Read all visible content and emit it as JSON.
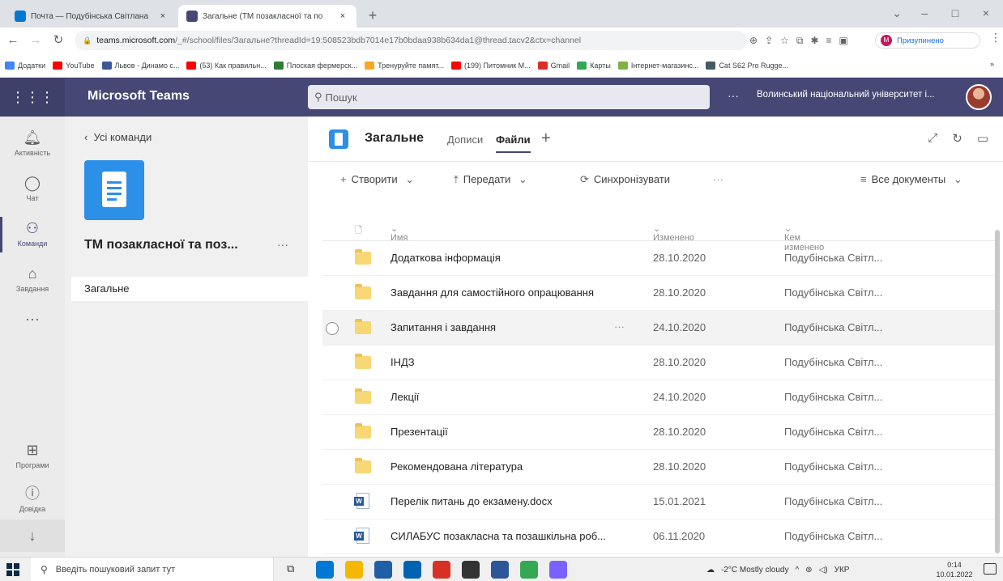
{
  "browser": {
    "tabs": [
      {
        "title": "Почта — Подубінська Світлана",
        "close": "×"
      },
      {
        "title": "Загальне (ТМ позакласної та по",
        "close": "×"
      }
    ],
    "new_tab": "+",
    "window_controls": [
      "⌄",
      "–",
      "□",
      "×"
    ],
    "url_host": "teams.microsoft.com",
    "url_rest": "/_#/school/files/Загальне?threadId=19:508523bdb7014e17b0bdaa938b634da1@thread.tacv2&ctx=channel",
    "profile_status": "Призупинено",
    "profile_initial": "M",
    "bookmarks": [
      {
        "label": "Додатки",
        "color": "#4285f4"
      },
      {
        "label": "YouTube",
        "color": "#ff0000"
      },
      {
        "label": "Львов - Динамо с...",
        "color": "#3b5998"
      },
      {
        "label": "(53) Как правильн...",
        "color": "#ff0000"
      },
      {
        "label": "Плоская фермерск...",
        "color": "#2e7d32"
      },
      {
        "label": "Тренуруйте памят...",
        "color": "#f9a825"
      },
      {
        "label": "(199) Питомник М...",
        "color": "#ff0000"
      },
      {
        "label": "Gmail",
        "color": "#d93025"
      },
      {
        "label": "Карты",
        "color": "#34a853"
      },
      {
        "label": "Інтернет-магазинс...",
        "color": "#7cb342"
      },
      {
        "label": "Cat S62 Pro Rugge...",
        "color": "#455a64"
      }
    ],
    "bookmarks_more": "»"
  },
  "teams": {
    "brand": "Microsoft Teams",
    "search_placeholder": "Пошук",
    "more": "···",
    "org": "Волинський національний університет і...",
    "rail": [
      {
        "label": "Активність",
        "icon": "🔔"
      },
      {
        "label": "Чат",
        "icon": "💬"
      },
      {
        "label": "Команди",
        "icon": "👥"
      },
      {
        "label": "Завдання",
        "icon": "🎒"
      },
      {
        "label": "···",
        "icon": ""
      },
      {
        "label": "Програми",
        "icon": "⊞"
      },
      {
        "label": "Довідка",
        "icon": "?"
      },
      {
        "label": "",
        "icon": "↓"
      }
    ],
    "back_label": "Усі команди",
    "team_name": "ТМ позакласної та поз...",
    "team_more": "···",
    "channel": "Загальне",
    "channel_title": "Загальне",
    "tabs": [
      "Дописи",
      "Файли"
    ],
    "tab_add": "+",
    "commands": {
      "create": "Створити",
      "upload": "Передати",
      "sync": "Синхронізувати",
      "more": "···",
      "view": "Все документы"
    },
    "columns": {
      "name": "Имя",
      "modified": "Изменено",
      "modified_by": "Кем изменено"
    },
    "files": [
      {
        "type": "folder",
        "name": "Додаткова інформація",
        "date": "28.10.2020",
        "by": "Подубінська Світл..."
      },
      {
        "type": "folder",
        "name": "Завдання для самостійного опрацювання",
        "date": "28.10.2020",
        "by": "Подубінська Світл..."
      },
      {
        "type": "folder",
        "name": "Запитання і завдання",
        "date": "24.10.2020",
        "by": "Подубінська Світл...",
        "selected": true
      },
      {
        "type": "folder",
        "name": "ІНДЗ",
        "date": "28.10.2020",
        "by": "Подубінська Світл..."
      },
      {
        "type": "folder",
        "name": "Лекції",
        "date": "24.10.2020",
        "by": "Подубінська Світл..."
      },
      {
        "type": "folder",
        "name": "Презентації",
        "date": "28.10.2020",
        "by": "Подубінська Світл..."
      },
      {
        "type": "folder",
        "name": "Рекомендована література",
        "date": "28.10.2020",
        "by": "Подубінська Світл..."
      },
      {
        "type": "word",
        "name": "Перелік питань до екзамену.docx",
        "date": "15.01.2021",
        "by": "Подубінська Світл..."
      },
      {
        "type": "word",
        "name": "СИЛАБУС позакласна та позашкільна роб...",
        "date": "06.11.2020",
        "by": "Подубінська Світл..."
      }
    ]
  },
  "taskbar": {
    "search_placeholder": "Введіть пошуковий запит тут",
    "weather": "-2°C Mostly cloudy",
    "lang": "УКР",
    "time": "0:14",
    "date": "10.01.2022",
    "app_colors": [
      "#0078d4",
      "#f5b800",
      "#1f5fa8",
      "#0063b1",
      "#d93025",
      "#333333",
      "#2b579a",
      "#34a853",
      "#7b61ff"
    ]
  }
}
